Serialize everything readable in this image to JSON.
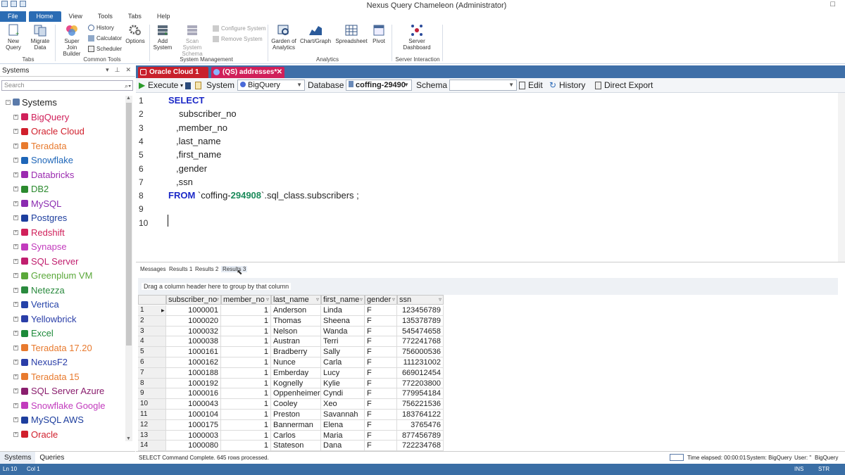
{
  "window": {
    "title": "Nexus Query Chameleon (Administrator)"
  },
  "menu": [
    "File",
    "Home",
    "View",
    "Tools",
    "Tabs",
    "Help"
  ],
  "ribbon": {
    "new_query": "New Query",
    "migrate_data": "Migrate Data",
    "group_tabs": "Tabs",
    "super_join": "Super Join Builder",
    "history": "History",
    "calculator": "Calculator",
    "scheduler": "Scheduler",
    "options": "Options",
    "group_common": "Common Tools",
    "add_system": "Add System",
    "scan_schema": "Scan System Schema",
    "configure_system": "Configure System",
    "remove_system": "Remove System",
    "group_system": "System Management",
    "garden": "Garden of Analytics",
    "chart_graph": "Chart/Graph",
    "spreadsheet": "Spreadsheet",
    "pivot": "Pivot",
    "group_analytics": "Analytics",
    "server_dashboard": "Server Dashboard",
    "group_server": "Server Interaction"
  },
  "left_panel": {
    "title": "Systems",
    "search_placeholder": "Search",
    "root": "Systems",
    "systems": [
      {
        "name": "BigQuery",
        "color": "#d0205a"
      },
      {
        "name": "Oracle Cloud",
        "color": "#d01f2c"
      },
      {
        "name": "Teradata",
        "color": "#e87a2e"
      },
      {
        "name": "Snowflake",
        "color": "#1e66b8"
      },
      {
        "name": "Databricks",
        "color": "#9b2bb0"
      },
      {
        "name": "DB2",
        "color": "#2b8a2e"
      },
      {
        "name": "MySQL",
        "color": "#8a2bb0"
      },
      {
        "name": "Postgres",
        "color": "#1d3e9e"
      },
      {
        "name": "Redshift",
        "color": "#d0205a"
      },
      {
        "name": "Synapse",
        "color": "#c23bbd"
      },
      {
        "name": "SQL Server",
        "color": "#c01e6e"
      },
      {
        "name": "Greenplum VM",
        "color": "#5aa83a"
      },
      {
        "name": "Netezza",
        "color": "#2a8a3e"
      },
      {
        "name": "Vertica",
        "color": "#2442a8"
      },
      {
        "name": "Yellowbrick",
        "color": "#2a3ea8"
      },
      {
        "name": "Excel",
        "color": "#1d8a3a"
      },
      {
        "name": "Teradata 17.20",
        "color": "#e87a2e"
      },
      {
        "name": "NexusF2",
        "color": "#2a3ea8"
      },
      {
        "name": "Teradata 15",
        "color": "#e87a2e"
      },
      {
        "name": "SQL Server Azure",
        "color": "#8a1e6e"
      },
      {
        "name": "Snowflake Google",
        "color": "#c23bbd"
      },
      {
        "name": "MySQL AWS",
        "color": "#1d3e9e"
      },
      {
        "name": "Oracle",
        "color": "#d01f2c"
      }
    ],
    "tabs": [
      "Systems",
      "Queries"
    ]
  },
  "editor_tabs": [
    {
      "label": "Oracle Cloud 1",
      "color": "#cc1e2c"
    },
    {
      "label": "(QS) addresses*",
      "color": "#d0205a"
    }
  ],
  "toolbar": {
    "execute": "Execute",
    "system_label": "System",
    "system_value": "BigQuery",
    "database_label": "Database",
    "database_value": "coffing-29490",
    "schema_label": "Schema",
    "schema_value": "",
    "edit": "Edit",
    "history": "History",
    "direct_export": "Direct Export"
  },
  "code": {
    "l1": "SELECT",
    "l2": "subscriber_no",
    "l3": ",member_no",
    "l4": ",last_name",
    "l5": ",first_name",
    "l6": ",gender",
    "l7": ",ssn",
    "l8_kw": "FROM",
    "l8_a": "`coffing-",
    "l8_b": "294908",
    "l8_c": "`.sql_class.subscribers ;",
    "line_numbers": [
      "1",
      "2",
      "3",
      "4",
      "5",
      "6",
      "7",
      "8",
      "9",
      "10"
    ]
  },
  "result_tabs": [
    "Messages",
    "Results 1",
    "Results 2",
    "Results 3"
  ],
  "group_hint": "Drag a column header here to group by that column",
  "grid": {
    "columns": [
      "subscriber_no",
      "member_no",
      "last_name",
      "first_name",
      "gender",
      "ssn"
    ],
    "rows": [
      [
        "1",
        "1000001",
        "1",
        "Anderson",
        "Linda",
        "F",
        "123456789"
      ],
      [
        "2",
        "1000020",
        "1",
        "Thomas",
        "Sheena",
        "F",
        "135378789"
      ],
      [
        "3",
        "1000032",
        "1",
        "Nelson",
        "Wanda",
        "F",
        "545474658"
      ],
      [
        "4",
        "1000038",
        "1",
        "Austran",
        "Terri",
        "F",
        "772241768"
      ],
      [
        "5",
        "1000161",
        "1",
        "Bradberry",
        "Sally",
        "F",
        "756000536"
      ],
      [
        "6",
        "1000162",
        "1",
        "Nunce",
        "Carla",
        "F",
        "111231002"
      ],
      [
        "7",
        "1000188",
        "1",
        "Emberday",
        "Lucy",
        "F",
        "669012454"
      ],
      [
        "8",
        "1000192",
        "1",
        "Kognelly",
        "Kylie",
        "F",
        "772203800"
      ],
      [
        "9",
        "1000016",
        "1",
        "Oppenheimer",
        "Cyndi",
        "F",
        "779954184"
      ],
      [
        "10",
        "1000043",
        "1",
        "Cooley",
        "Xeo",
        "F",
        "756221536"
      ],
      [
        "11",
        "1000104",
        "1",
        "Preston",
        "Savannah",
        "F",
        "183764122"
      ],
      [
        "12",
        "1000175",
        "1",
        "Bannerman",
        "Elena",
        "F",
        "3765476"
      ],
      [
        "13",
        "1000003",
        "1",
        "Carlos",
        "Maria",
        "F",
        "877456789"
      ],
      [
        "14",
        "1000080",
        "1",
        "Stateson",
        "Dana",
        "F",
        "722234768"
      ]
    ]
  },
  "status": {
    "message": "SELECT Command Complete.  645 rows processed.",
    "elapsed": "Time elapsed: 00:00:01",
    "system": "System: BigQuery",
    "user": "User: \"",
    "db": "BigQuery",
    "ln": "Ln 10",
    "col": "Col 1",
    "ins": "INS",
    "str": "STR"
  }
}
